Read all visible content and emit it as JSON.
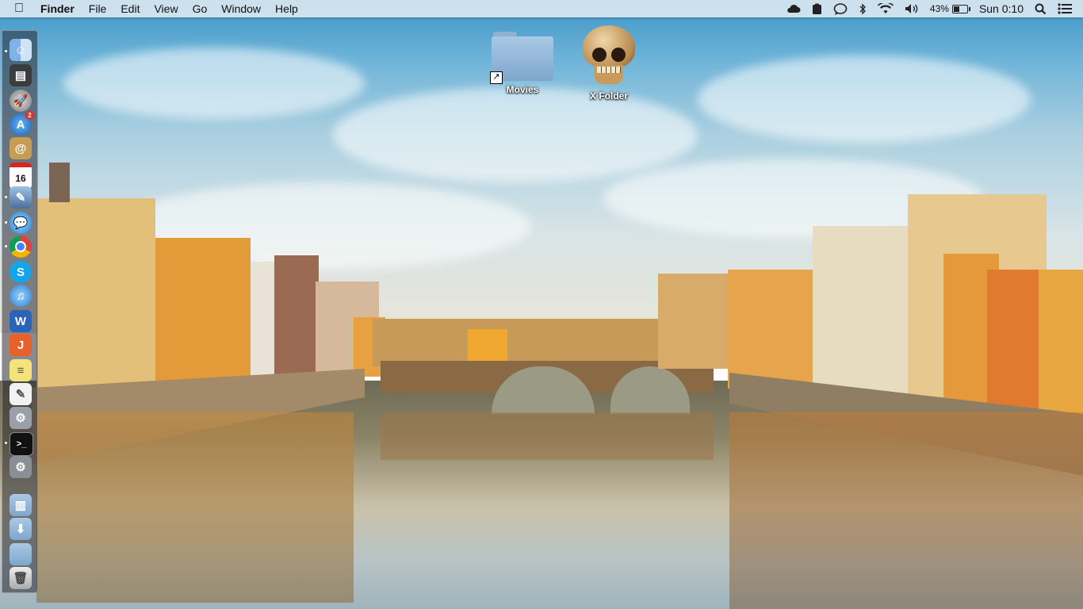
{
  "menubar": {
    "app_name": "Finder",
    "menus": [
      "File",
      "Edit",
      "View",
      "Go",
      "Window",
      "Help"
    ],
    "battery_percent": "43%",
    "battery_level": 0.43,
    "clock": "Sun 0:10",
    "status_icons": [
      "cloud-icon",
      "clipboard-icon",
      "chat-bubble-icon",
      "bluetooth-icon",
      "wifi-icon",
      "volume-icon",
      "battery-icon",
      "spotlight-search-icon",
      "notification-center-icon"
    ]
  },
  "desktop": {
    "icons": [
      {
        "label": "Movies",
        "type": "folder-alias"
      },
      {
        "label": "X Folder",
        "type": "skull"
      }
    ]
  },
  "dock": {
    "calendar_day": "16",
    "app_store_badge": "2",
    "items": [
      "finder-icon",
      "dashboard-icon",
      "launchpad-icon",
      "app-store-icon",
      "contacts-icon",
      "calendar-icon",
      "preview-icon",
      "messages-icon",
      "chrome-icon",
      "skype-icon",
      "itunes-icon",
      "word-icon",
      "app-icon",
      "stickies-icon",
      "textedit-icon",
      "utility-icon",
      "terminal-icon",
      "system-preferences-icon",
      "documents-folder-icon",
      "downloads-folder-icon",
      "folder-icon",
      "trash-icon"
    ]
  }
}
